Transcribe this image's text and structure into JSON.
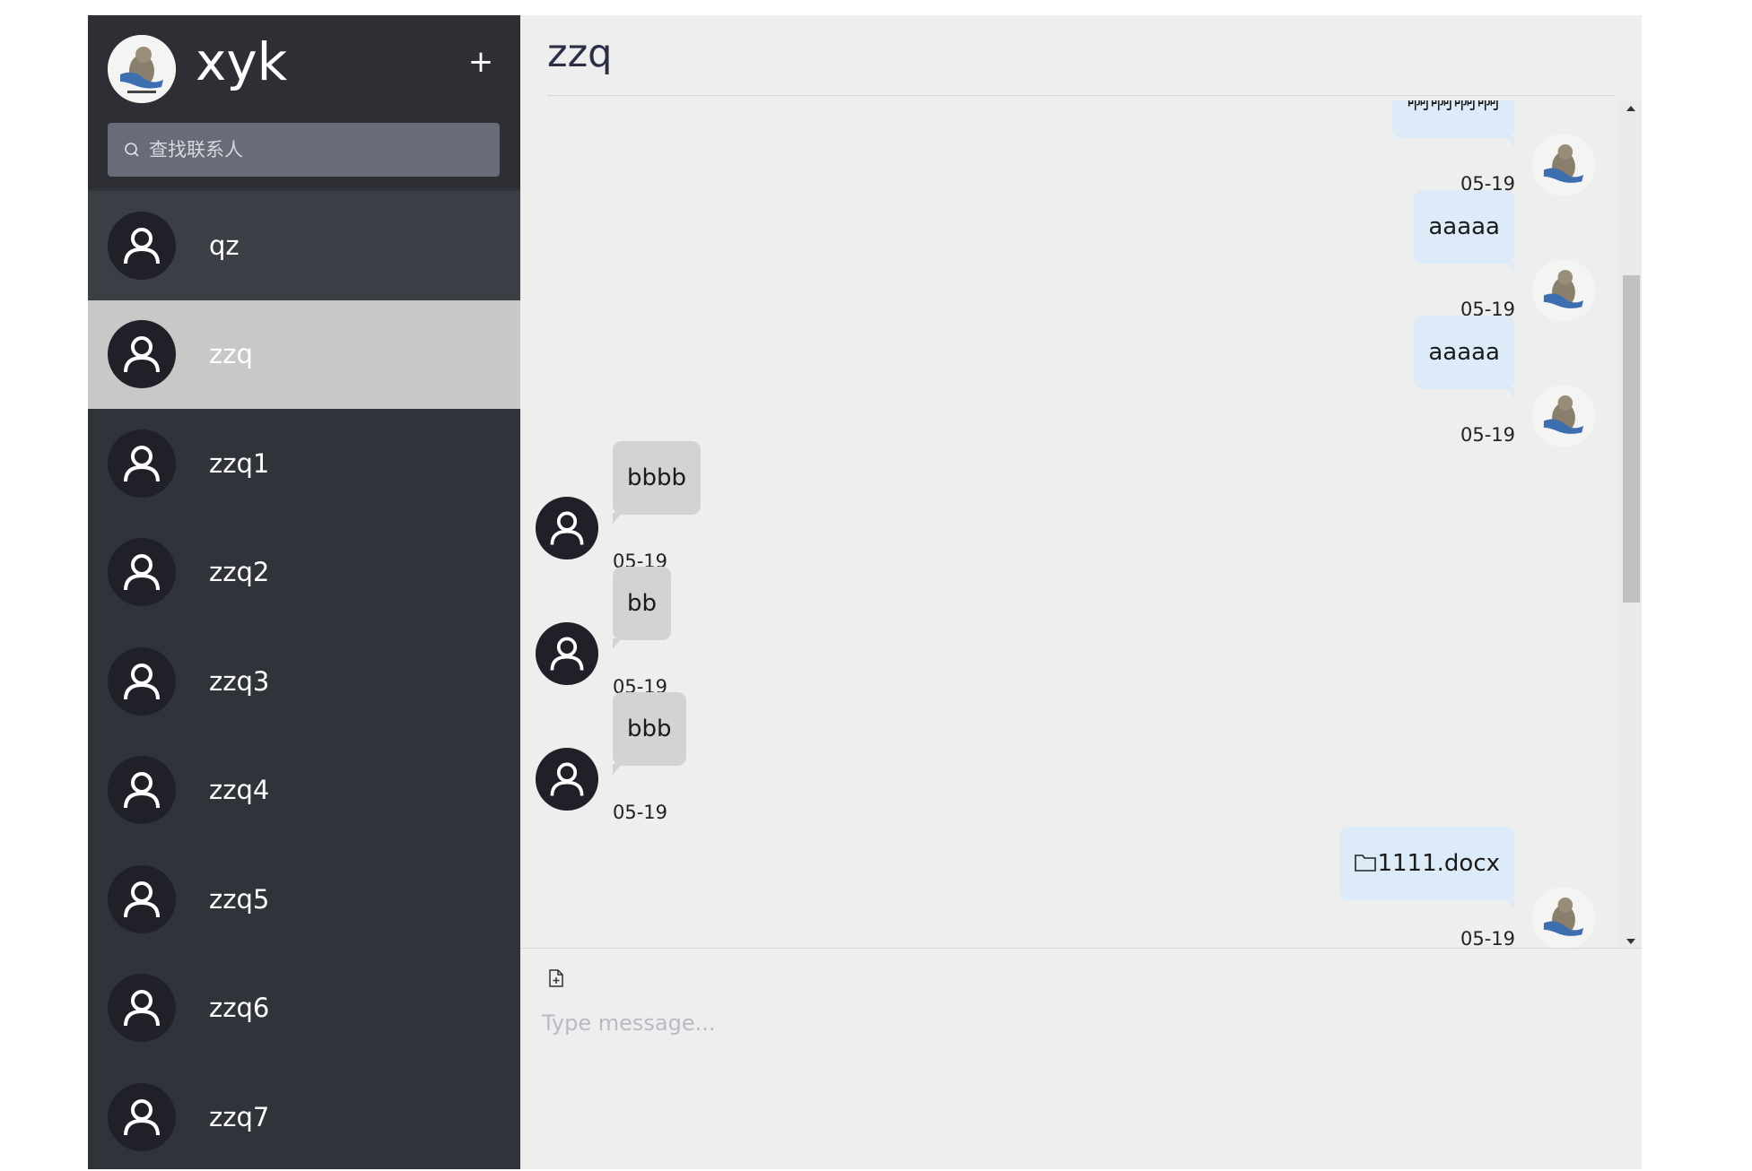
{
  "me": {
    "name": "xyk"
  },
  "sidebar": {
    "add_label": "+",
    "search_placeholder": "查找联系人",
    "contacts": [
      {
        "name": "qz"
      },
      {
        "name": "zzq"
      },
      {
        "name": "zzq1"
      },
      {
        "name": "zzq2"
      },
      {
        "name": "zzq3"
      },
      {
        "name": "zzq4"
      },
      {
        "name": "zzq5"
      },
      {
        "name": "zzq6"
      },
      {
        "name": "zzq7"
      }
    ]
  },
  "chat": {
    "title": "zzq",
    "messages": [
      {
        "dir": "out",
        "text": "啊啊啊啊",
        "time": "05-19"
      },
      {
        "dir": "out",
        "text": "aaaaa",
        "time": "05-19"
      },
      {
        "dir": "out",
        "text": "aaaaa",
        "time": "05-19"
      },
      {
        "dir": "in",
        "text": "bbbb",
        "time": "05-19"
      },
      {
        "dir": "in",
        "text": "bb",
        "time": "05-19"
      },
      {
        "dir": "in",
        "text": "bbb",
        "time": "05-19"
      },
      {
        "dir": "out",
        "text": "1111.docx",
        "time": "05-19",
        "icon": "folder-icon"
      }
    ],
    "input_placeholder": "Type message..."
  },
  "colors": {
    "sidebar_bg": "#31333a",
    "active_contact_bg": "#c8c8c8",
    "chat_bg": "#eeeeee",
    "bubble_out": "#dcebf7",
    "bubble_in": "#d3d3d3"
  }
}
